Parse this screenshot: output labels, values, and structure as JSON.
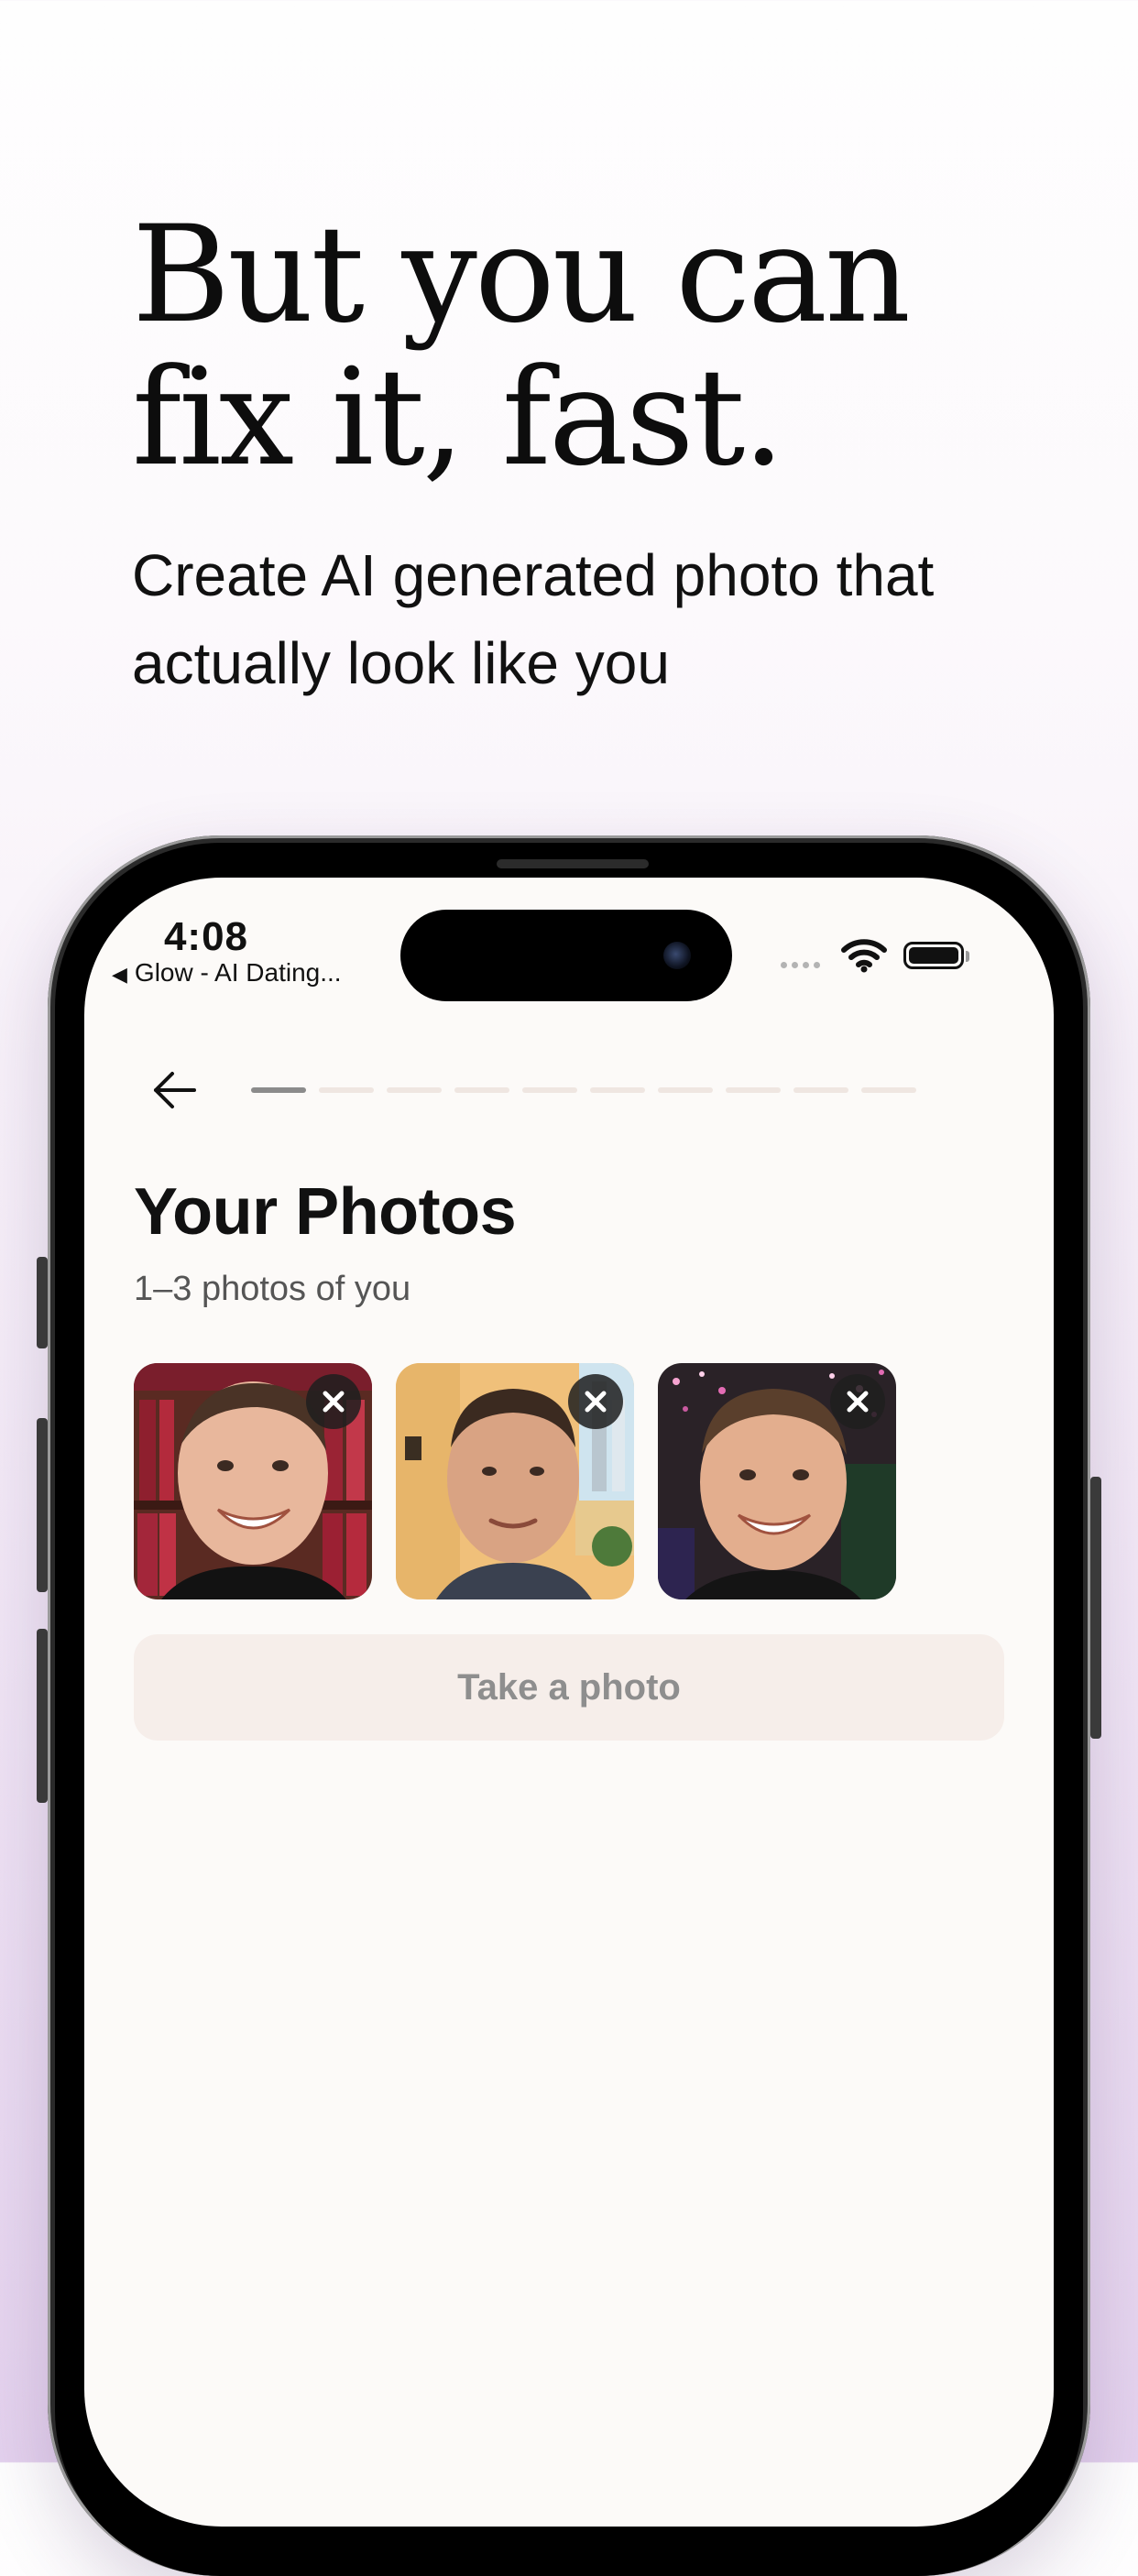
{
  "marketing": {
    "headline_line1": "But you can",
    "headline_line2": "fix it, fast.",
    "subhead": "Create AI generated photo that actually look like you"
  },
  "status_bar": {
    "time": "4:08",
    "back_app": "Glow - AI Dating..."
  },
  "nav": {
    "progress_steps": 10,
    "current_step": 1
  },
  "page": {
    "title": "Your Photos",
    "subtitle": "1–3 photos of you"
  },
  "photos": [
    {
      "remove_label": "×"
    },
    {
      "remove_label": "×"
    },
    {
      "remove_label": "×"
    }
  ],
  "actions": {
    "take_photo": "Take a photo"
  },
  "colors": {
    "screen_bg": "#fcfaf8",
    "take_photo_bg": "#f6eeea",
    "take_photo_text": "#8e8e8e",
    "progress_active": "#8b8b8b",
    "progress_inactive": "#efe6e1"
  }
}
